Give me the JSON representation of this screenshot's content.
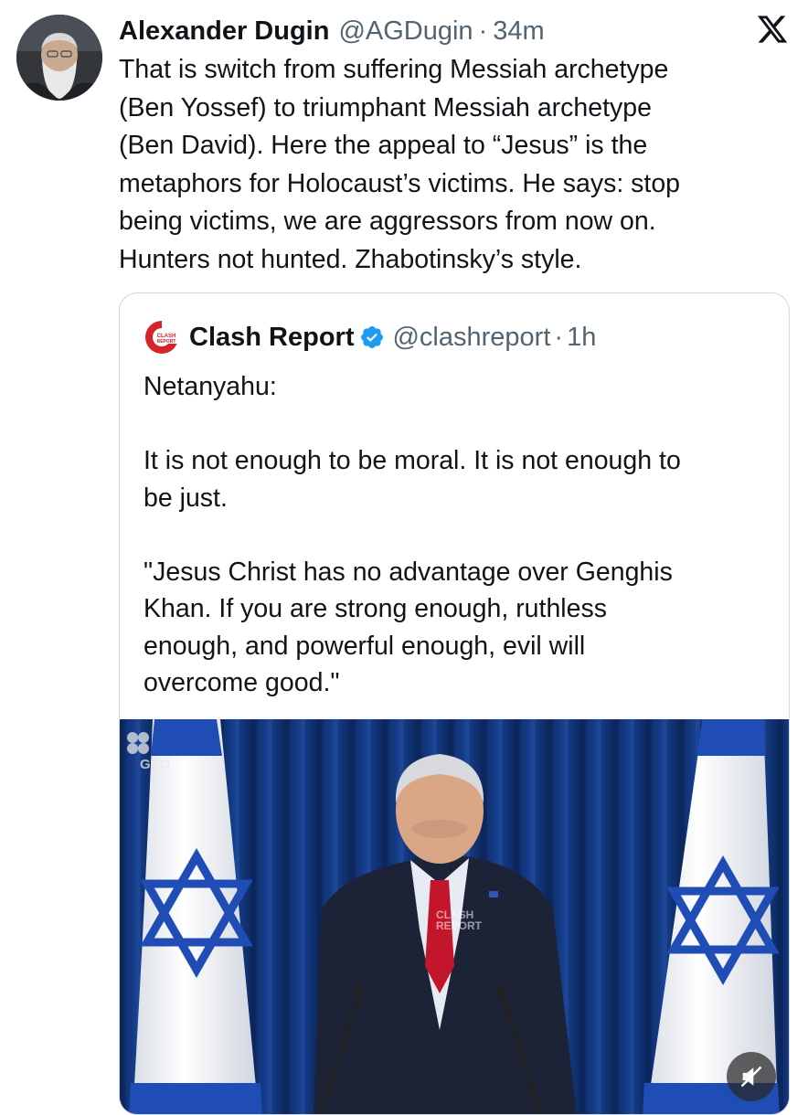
{
  "tweet": {
    "author_name": "Alexander Dugin",
    "author_handle": "@AGDugin",
    "separator": "·",
    "time": "34m",
    "text": "That is switch from suffering Messiah archetype\n(Ben Yossef) to triumphant Messiah archetype\n(Ben David). Here the appeal to “Jesus” is the\nmetaphors for Holocaust’s victims. He says: stop\nbeing victims, we are aggressors from now on.\nHunters not hunted. Zhabotinsky’s style."
  },
  "quote": {
    "author_name": "Clash Report",
    "author_handle": "@clashreport",
    "separator": "·",
    "time": "1h",
    "avatar_text_top": "CLASH",
    "avatar_text_bottom": "REPORT",
    "text": "Netanyahu:\n\nIt is not enough to be moral. It is not enough to\nbe just.\n\n\"Jesus Christ has no advantage over Genghis\nKhan. If you are strong enough, ruthless\nenough, and powerful enough, evil will\novercome good.\"",
    "media": {
      "watermark": "GPO",
      "overlay_top": "CLASH",
      "overlay_bottom": "REPORT"
    }
  },
  "icons": {
    "x_logo": "x-logo-icon",
    "verified": "verified-badge-icon",
    "mute": "muted-speaker-icon"
  },
  "colors": {
    "text": "#0f1419",
    "secondary": "#536471",
    "verified_blue": "#1d9bf0",
    "clash_red": "#d8232a",
    "border": "#cfd9de"
  }
}
